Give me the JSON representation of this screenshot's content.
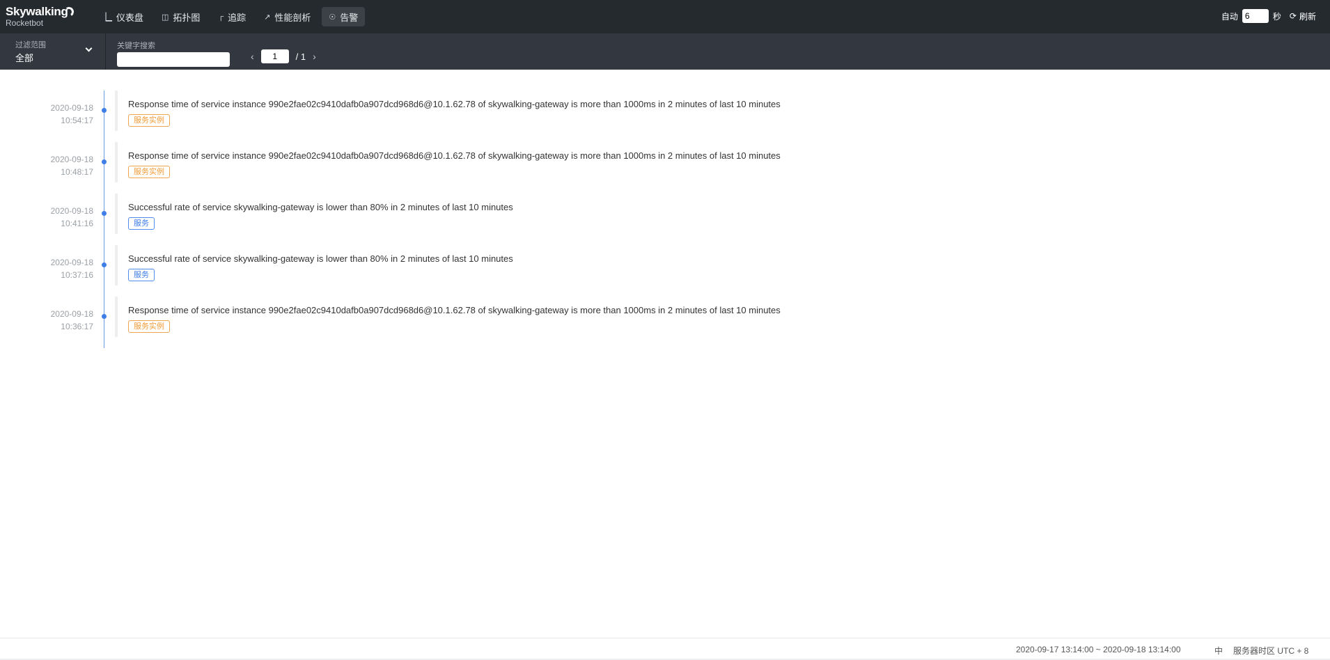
{
  "app": {
    "brand": "Skywalking",
    "subtitle": "Rocketbot"
  },
  "nav": {
    "items": [
      {
        "label": "仪表盘",
        "icon": "dashboard-icon"
      },
      {
        "label": "拓扑图",
        "icon": "topology-icon"
      },
      {
        "label": "追踪",
        "icon": "trace-icon"
      },
      {
        "label": "性能剖析",
        "icon": "profile-icon"
      },
      {
        "label": "告警",
        "icon": "alarm-icon",
        "active": true
      }
    ]
  },
  "auto_refresh": {
    "label": "自动",
    "interval": "6",
    "unit": "秒",
    "refresh_label": "刷新"
  },
  "filter": {
    "scope_label": "过滤范围",
    "scope_value": "全部",
    "keyword_label": "关键字搜索",
    "keyword_value": ""
  },
  "pager": {
    "current": "1",
    "total_text": "/ 1"
  },
  "alarms": [
    {
      "date": "2020-09-18",
      "time": "10:54:17",
      "message": "Response time of service instance 990e2fae02c9410dafb0a907dcd968d6@10.1.62.78 of skywalking-gateway is more than 1000ms in 2 minutes of last 10 minutes",
      "tag": "服务实例",
      "tag_type": "instance"
    },
    {
      "date": "2020-09-18",
      "time": "10:48:17",
      "message": "Response time of service instance 990e2fae02c9410dafb0a907dcd968d6@10.1.62.78 of skywalking-gateway is more than 1000ms in 2 minutes of last 10 minutes",
      "tag": "服务实例",
      "tag_type": "instance"
    },
    {
      "date": "2020-09-18",
      "time": "10:41:16",
      "message": "Successful rate of service skywalking-gateway is lower than 80% in 2 minutes of last 10 minutes",
      "tag": "服务",
      "tag_type": "service"
    },
    {
      "date": "2020-09-18",
      "time": "10:37:16",
      "message": "Successful rate of service skywalking-gateway is lower than 80% in 2 minutes of last 10 minutes",
      "tag": "服务",
      "tag_type": "service"
    },
    {
      "date": "2020-09-18",
      "time": "10:36:17",
      "message": "Response time of service instance 990e2fae02c9410dafb0a907dcd968d6@10.1.62.78 of skywalking-gateway is more than 1000ms in 2 minutes of last 10 minutes",
      "tag": "服务实例",
      "tag_type": "instance"
    }
  ],
  "footer": {
    "time_range": "2020-09-17 13:14:00 ~ 2020-09-18 13:14:00",
    "lang": "中",
    "timezone": "服务器时区 UTC + 8"
  }
}
